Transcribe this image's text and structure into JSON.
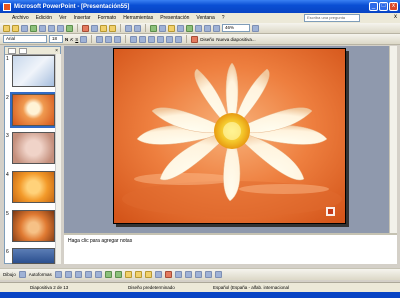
{
  "window": {
    "title": "Microsoft PowerPoint - [Presentación55]",
    "buttons": [
      "_",
      "□",
      "x"
    ]
  },
  "menu": {
    "items": [
      "Archivo",
      "Edición",
      "Ver",
      "Insertar",
      "Formato",
      "Herramientas",
      "Presentación",
      "Ventana",
      "?"
    ],
    "help_placeholder": "Escriba una pregunta",
    "close_glyph": "x"
  },
  "toolbar": {
    "zoom": "46%",
    "font_name": "Arial",
    "font_size": "18",
    "bold": "N",
    "italic": "K",
    "underline": "S",
    "design_label": "Diseño",
    "new_slide_label": "Nueva diapositiva..."
  },
  "slides": {
    "numbers": [
      "1",
      "2",
      "3",
      "4",
      "5",
      "6"
    ],
    "selected": 2,
    "total": 13
  },
  "notes": {
    "placeholder": "Haga clic para agregar notas"
  },
  "drawbar": {
    "draw_label": "Dibujo",
    "autoshapes_label": "Autoformas"
  },
  "status": {
    "slide": "Diapositiva 2 de 13",
    "design": "Diseño predeterminado",
    "language": "Español (España - alfab. internacional"
  },
  "colors": {
    "titlebar": "#0a4fd4",
    "workspace": "#8f99ad",
    "slide_bg": "#ec7a3e",
    "selection": "#316ac5"
  }
}
